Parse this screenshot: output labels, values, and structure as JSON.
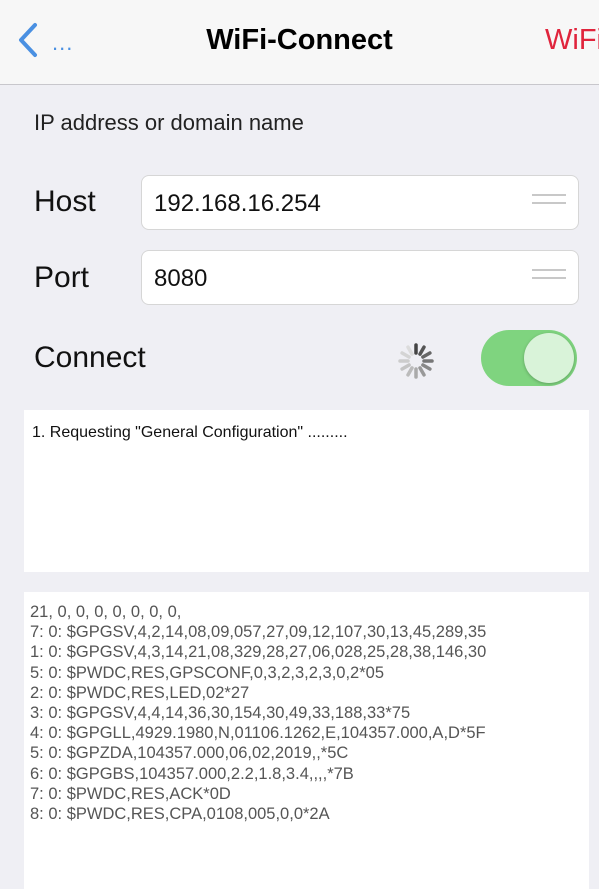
{
  "nav": {
    "back_label": "...",
    "title": "WiFi-Connect",
    "right_label": "WiFi"
  },
  "section_label": "IP address or domain name",
  "host": {
    "label": "Host",
    "value": "192.168.16.254"
  },
  "port": {
    "label": "Port",
    "value": "8080"
  },
  "connect": {
    "label": "Connect",
    "toggle_on": true
  },
  "status": {
    "text": "1. Requesting \"General Configuration\" ........."
  },
  "log": {
    "lines": [
      "21, 0, 0, 0, 0, 0, 0, 0,",
      "7: 0: $GPGSV,4,2,14,08,09,057,27,09,12,107,30,13,45,289,35",
      "1: 0: $GPGSV,4,3,14,21,08,329,28,27,06,028,25,28,38,146,30",
      "5: 0: $PWDC,RES,GPSCONF,0,3,2,3,2,3,0,2*05",
      "2: 0: $PWDC,RES,LED,02*27",
      "3: 0: $GPGSV,4,4,14,36,30,154,30,49,33,188,33*75",
      "4: 0: $GPGLL,4929.1980,N,01106.1262,E,104357.000,A,D*5F",
      "5: 0: $GPZDA,104357.000,06,02,2019,,*5C",
      "6: 0: $GPGBS,104357.000,2.2,1.8,3.4,,,,*7B",
      "7: 0: $PWDC,RES,ACK*0D",
      "8: 0: $PWDC,RES,CPA,0108,005,0,0*2A"
    ]
  },
  "colors": {
    "accent_blue": "#4a90e2",
    "accent_red": "#e0243c",
    "toggle_green": "#7fd47f"
  }
}
